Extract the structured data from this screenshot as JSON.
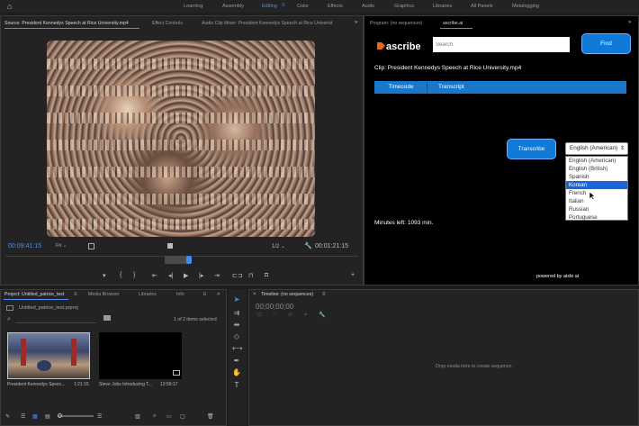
{
  "topbar": {
    "workspaces": [
      "Learning",
      "Assembly",
      "Editing",
      "Color",
      "Effects",
      "Audio",
      "Graphics",
      "Libraries",
      "All Panels",
      "Metalogging"
    ],
    "active": "Editing"
  },
  "source_panel": {
    "tabs": [
      "Source: President Kennedys Speech at Rice University.mp4",
      "Effect Controls",
      "Audio Clip Mixer: President Kennedys Speech at Rice Universit"
    ],
    "timecode_left": "00:09:41:15",
    "fit": "Fit",
    "ratio": "1/2",
    "timecode_right": "00:01:21:15"
  },
  "program_panel": {
    "tabs": [
      "Program: (no sequences)",
      "ascribe.ai"
    ]
  },
  "ascribe": {
    "logo": "ascribe",
    "search_placeholder": "Search",
    "find_label": "Find",
    "clip": "Clip: President Kennedys Speech at Rice University.mp4",
    "tab_timecode": "Timecode",
    "tab_transcript": "Transcript",
    "transcribe_label": "Transcribe",
    "selected_language": "English (American)",
    "languages": [
      "English (American)",
      "English (British)",
      "Spanish",
      "Korean",
      "French",
      "Italian",
      "Russian",
      "Portuguese"
    ],
    "highlighted_language": "Korean",
    "minutes_left": "Minutes left: 1093 min.",
    "powered": "powered by aixle ai"
  },
  "project_panel": {
    "tabs": [
      "Project: Untitled_patrice_test",
      "Media Browser",
      "Libraries",
      "Info",
      "E"
    ],
    "project_file": "Untitled_patrice_test.prproj",
    "items_selected": "1 of 2 items selected",
    "clips": [
      {
        "name": "President Kennedys Speec...",
        "duration": "1:21:15"
      },
      {
        "name": "Steve Jobs Introducing T...",
        "duration": "13:59:17"
      }
    ]
  },
  "timeline_panel": {
    "title": "Timeline: (no sequences)",
    "timecode": "00;00;00;00",
    "drop_message": "Drop media here to create sequence."
  },
  "colors": {
    "accent": "#4d8ef5",
    "ascribe_blue": "#0f7ad8",
    "panel_bg": "#232323"
  }
}
